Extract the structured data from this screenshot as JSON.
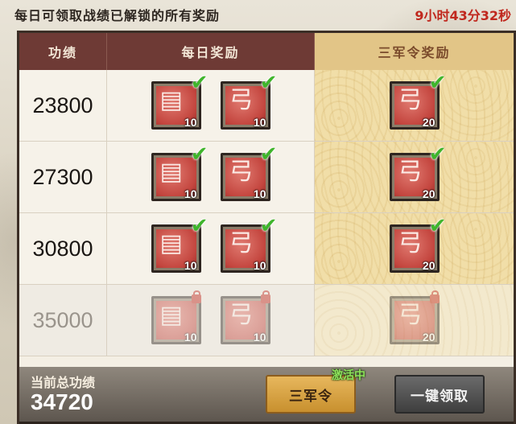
{
  "header": {
    "title": "每日可领取战绩已解锁的所有奖励",
    "timer": "9小时43分32秒",
    "timer_color": "#c0281e"
  },
  "table": {
    "columns": [
      "功绩",
      "每日奖励",
      "三军令奖励"
    ],
    "rows": [
      {
        "score": "23800",
        "daily": [
          {
            "icon": "scroll-icon",
            "qty": "10",
            "claimed": true
          },
          {
            "icon": "boot-icon",
            "qty": "10",
            "claimed": true
          }
        ],
        "army": {
          "icon": "boot-icon",
          "qty": "20",
          "claimed": true
        },
        "locked": false
      },
      {
        "score": "27300",
        "daily": [
          {
            "icon": "scroll-icon",
            "qty": "10",
            "claimed": true
          },
          {
            "icon": "boot-icon",
            "qty": "10",
            "claimed": true
          }
        ],
        "army": {
          "icon": "boot-icon",
          "qty": "20",
          "claimed": true
        },
        "locked": false
      },
      {
        "score": "30800",
        "daily": [
          {
            "icon": "scroll-icon",
            "qty": "10",
            "claimed": true
          },
          {
            "icon": "boot-icon",
            "qty": "10",
            "claimed": true
          }
        ],
        "army": {
          "icon": "boot-icon",
          "qty": "20",
          "claimed": true
        },
        "locked": false
      },
      {
        "score": "35000",
        "daily": [
          {
            "icon": "scroll-icon",
            "qty": "10",
            "claimed": false
          },
          {
            "icon": "boot-icon",
            "qty": "10",
            "claimed": false
          }
        ],
        "army": {
          "icon": "boot-icon",
          "qty": "20",
          "claimed": false
        },
        "locked": true
      }
    ]
  },
  "footer": {
    "label": "当前总功绩",
    "value": "34720",
    "army_button": "三军令",
    "active_tag": "激活中",
    "claim_button": "一键领取"
  },
  "colors": {
    "header_bar": "#6e3a35",
    "gold_column": "#f1dea8",
    "check": "#3fb52c"
  }
}
